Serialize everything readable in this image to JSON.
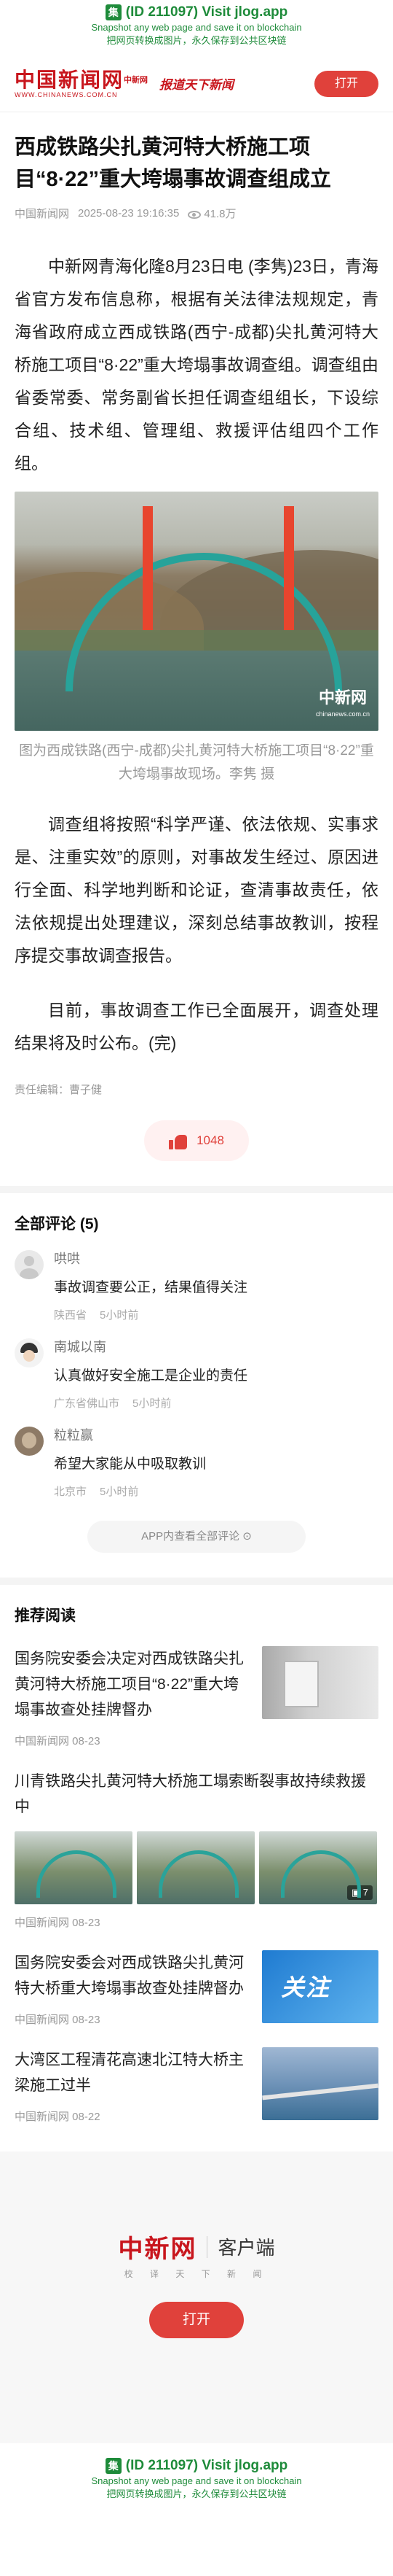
{
  "jlog": {
    "line1": "(ID 211097) Visit jlog.app",
    "line2": "Snapshot any web page and save it on blockchain",
    "line3": "把网页转换成图片，永久保存到公共区块链",
    "logo_char": "集"
  },
  "header": {
    "brand_cn": "中国新闻网",
    "brand_tag": "中新网",
    "brand_en": "WWW.CHINANEWS.COM.CN",
    "slogan": "报道天下新闻",
    "open_label": "打开"
  },
  "article": {
    "title": "西成铁路尖扎黄河特大桥施工项目“8·22”重大垮塌事故调查组成立",
    "source": "中国新闻网",
    "time": "2025-08-23 19:16:35",
    "views": "41.8万",
    "p1": "中新网青海化隆8月23日电 (李隽)23日，青海省官方发布信息称，根据有关法律法规规定，青海省政府成立西成铁路(西宁-成都)尖扎黄河特大桥施工项目“8·22”重大垮塌事故调查组。调查组由省委常委、常务副省长担任调查组组长，下设综合组、技术组、管理组、救援评估组四个工作组。",
    "photo_watermark": "中新网",
    "photo_watermark_url": "chinanews.com.cn",
    "caption": "图为西成铁路(西宁-成都)尖扎黄河特大桥施工项目“8·22”重大垮塌事故现场。李隽 摄",
    "p2": "调查组将按照“科学严谨、依法依规、实事求是、注重实效”的原则，对事故发生经过、原因进行全面、科学地判断和论证，查清事故责任，依法依规提出处理建议，深刻总结事故教训，按程序提交事故调查报告。",
    "p3": "目前，事故调查工作已全面展开，调查处理结果将及时公布。(完)",
    "editor": "责任编辑：曹子健",
    "likes": "1048"
  },
  "comments": {
    "title": "全部评论 (5)",
    "items": [
      {
        "name": "哄哄",
        "text": "事故调查要公正，结果值得关注",
        "location": "陕西省",
        "time": "5小时前"
      },
      {
        "name": "南城以南",
        "text": "认真做好安全施工是企业的责任",
        "location": "广东省佛山市",
        "time": "5小时前"
      },
      {
        "name": "粒粒赢",
        "text": "希望大家能从中吸取教训",
        "location": "北京市",
        "time": "5小时前"
      }
    ],
    "view_all": "APP内查看全部评论 ⊙"
  },
  "recommend": {
    "title": "推荐阅读",
    "items": [
      {
        "title": "国务院安委会决定对西成铁路尖扎黄河特大桥施工项目“8·22”重大垮塌事故查处挂牌督办",
        "meta": "中国新闻网 08-23"
      },
      {
        "title": "川青铁路尖扎黄河特大桥施工塌索断裂事故持续救援中",
        "meta": "中国新闻网 08-23",
        "badge": "7"
      },
      {
        "title": "国务院安委会对西成铁路尖扎黄河特大桥重大垮塌事故查处挂牌督办",
        "meta": "中国新闻网 08-23",
        "img_text": "关注"
      },
      {
        "title": "大湾区工程清花高速北江特大桥主梁施工过半",
        "meta": "中国新闻网 08-22"
      }
    ]
  },
  "footer": {
    "logo": "中新网",
    "client": "客户端",
    "tagline": "校 译 天 下 新 闻",
    "open_label": "打开"
  }
}
